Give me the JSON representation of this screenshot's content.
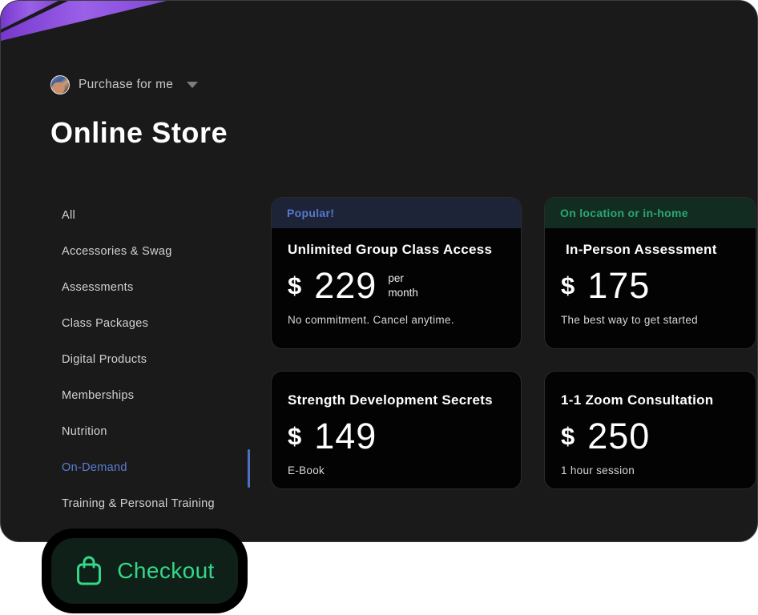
{
  "header": {
    "account_selector": {
      "label": "Purchase for me"
    },
    "title": "Online Store"
  },
  "sidebar": {
    "items": [
      {
        "label": "All",
        "active": false
      },
      {
        "label": "Accessories & Swag",
        "active": false
      },
      {
        "label": "Assessments",
        "active": false
      },
      {
        "label": "Class Packages",
        "active": false
      },
      {
        "label": "Digital Products",
        "active": false
      },
      {
        "label": "Memberships",
        "active": false
      },
      {
        "label": "Nutrition",
        "active": false
      },
      {
        "label": "On-Demand",
        "active": true
      },
      {
        "label": "Training & Personal Training",
        "active": false
      }
    ]
  },
  "products": [
    {
      "badge": "Popular!",
      "badge_style": "blue",
      "title": "Unlimited Group Class Access",
      "currency": "$",
      "price": "229",
      "suffix_line1": "per",
      "suffix_line2": "month",
      "subtext": "No commitment. Cancel anytime."
    },
    {
      "badge": "On location or in-home",
      "badge_style": "green",
      "title": "In-Person Assessment",
      "currency": "$",
      "price": "175",
      "subtext": "The best way to get started"
    },
    {
      "title": "Strength Development Secrets",
      "currency": "$",
      "price": "149",
      "subtext": "E-Book"
    },
    {
      "title": "1-1 Zoom Consultation",
      "currency": "$",
      "price": "250",
      "subtext": "1 hour session"
    }
  ],
  "checkout": {
    "label": "Checkout"
  },
  "colors": {
    "shell_background": "#1a1a1a",
    "card_background": "#030303",
    "active_sidebar_item": "#5b7dd6",
    "blue_badge_bg": "#1d2437",
    "blue_badge_text": "#5878cf",
    "green_badge_bg": "#132c21",
    "green_badge_text": "#29a873",
    "checkout_green": "#36d689",
    "checkout_bg": "#0e2018",
    "purple_decor": "#9a5ee6"
  }
}
